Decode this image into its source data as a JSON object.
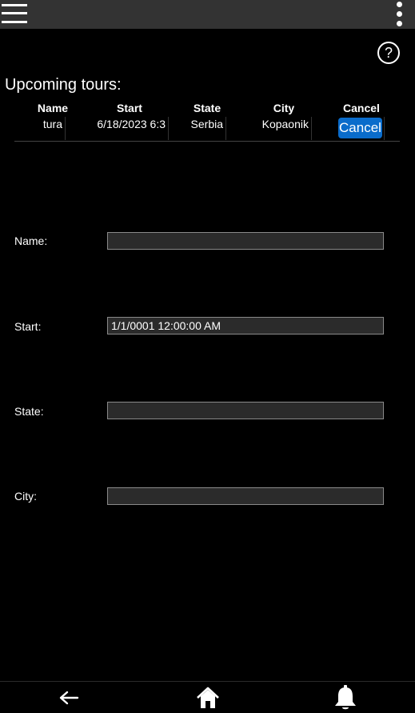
{
  "topbar": {
    "menu_icon": "hamburger-menu-icon",
    "more_icon": "kebab-more-icon"
  },
  "help": {
    "icon": "help-icon",
    "glyph": "?"
  },
  "tours": {
    "title": "Upcoming tours:",
    "columns": [
      "Name",
      "Start",
      "State",
      "City",
      "Cancel"
    ],
    "rows": [
      {
        "name": "tura",
        "start": "6/18/2023 6:3",
        "state": "Serbia",
        "city": "Kopaonik",
        "cancel_label": "Cancel"
      }
    ]
  },
  "form": {
    "name_label": "Name:",
    "name_value": "",
    "start_label": "Start:",
    "start_value": "1/1/0001 12:00:00 AM",
    "state_label": "State:",
    "state_value": "",
    "city_label": "City:",
    "city_value": ""
  },
  "bottom_nav": {
    "back_icon": "back-arrow-icon",
    "home_icon": "home-icon",
    "notifications_icon": "bell-icon"
  },
  "colors": {
    "background": "#000000",
    "topbar": "#333333",
    "accent": "#0a6ccb",
    "input_bg": "#2b2b2b"
  }
}
